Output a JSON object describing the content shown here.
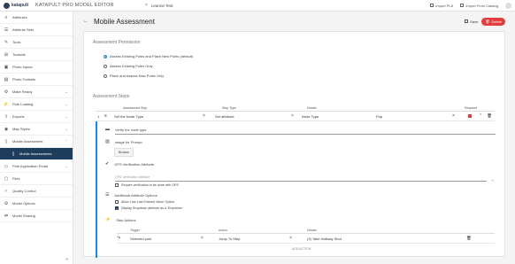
{
  "topbar": {
    "logo_text": "katapult",
    "app_title": "KATAPULT PRO MODEL EDITOR",
    "tab_label": "Leanne Test",
    "import_pla": "Import PLA",
    "import_catalog": "Import From Catalog"
  },
  "sidebar": {
    "items": [
      {
        "label": "Attributes",
        "icon": "≡",
        "chev": ""
      },
      {
        "label": "Attribute Sets",
        "icon": "☰",
        "chev": ""
      },
      {
        "label": "Tools",
        "icon": "✎",
        "chev": ""
      },
      {
        "label": "Toolsets",
        "icon": "⊞",
        "chev": ""
      },
      {
        "label": "Photo Inputs",
        "icon": "▣",
        "chev": ""
      },
      {
        "label": "Photo Toolsets",
        "icon": "▤",
        "chev": ""
      },
      {
        "label": "Make Ready",
        "icon": "⚙",
        "chev": "⌄"
      },
      {
        "label": "Pole Loading",
        "icon": "⚡",
        "chev": "⌄"
      },
      {
        "label": "Exports",
        "icon": "⇪",
        "chev": "⌄"
      },
      {
        "label": "Map Styles",
        "icon": "◉",
        "chev": "⌄"
      },
      {
        "label": "Mobile Assessment",
        "icon": "▯",
        "chev": "⌃"
      },
      {
        "label": "Mobile Assessments",
        "icon": "▯",
        "chev": "",
        "sub": true,
        "active": true
      },
      {
        "label": "Pole Application Portal",
        "icon": "▭",
        "chev": "⌄"
      },
      {
        "label": "Files",
        "icon": "▢",
        "chev": ""
      },
      {
        "label": "Quality Control",
        "icon": "✓",
        "chev": ""
      },
      {
        "label": "Model Options",
        "icon": "⚙",
        "chev": ""
      },
      {
        "label": "Model Sharing",
        "icon": "⇄",
        "chev": ""
      }
    ],
    "collapse_icon": "«"
  },
  "header": {
    "title": "Mobile Assessment",
    "save": "Save",
    "delete": "Delete"
  },
  "permission": {
    "title": "Assessment Permission",
    "options": [
      {
        "label": "Assess Existing Poles and Place New Poles (default)",
        "selected": true
      },
      {
        "label": "Assess Existing Poles Only",
        "selected": false
      },
      {
        "label": "Place and Assess New Poles Only",
        "selected": false
      }
    ]
  },
  "steps": {
    "title": "Assessment Steps",
    "columns": [
      "Assessment Step",
      "Step Type",
      "Details",
      "Required"
    ],
    "row": {
      "num": "1",
      "step": "Set the Node Type",
      "type": "Set attribute",
      "detail1": "Node Type",
      "detail2": "Pop"
    },
    "prompt": "Verify the node type.",
    "image_label": "Image for Prompt",
    "browse": "Browse",
    "gps_label": "GPS Verification Attribute",
    "gps_placeholder": "GPS Verification Attribute",
    "require_gps": "Require verification to be done with GPS",
    "addl_title": "Additional Attribute Options",
    "allow_last": "Allow 'Use Last Entered Value' Option",
    "display_dropdown": "Display Dropdown attribute as a 'Dropdown'",
    "step_actions": "Step Actions",
    "act_columns": [
      "Trigger",
      "Action",
      "Details"
    ],
    "act_row": {
      "trigger": "Selected pole",
      "action": "Jump To Step",
      "details": "(3) Take Hallway Shot"
    },
    "add_action": "ADD ACTION"
  },
  "colors": {
    "accent": "#1e88e5",
    "navy": "#1e3d5c",
    "danger": "#e43c3c"
  }
}
